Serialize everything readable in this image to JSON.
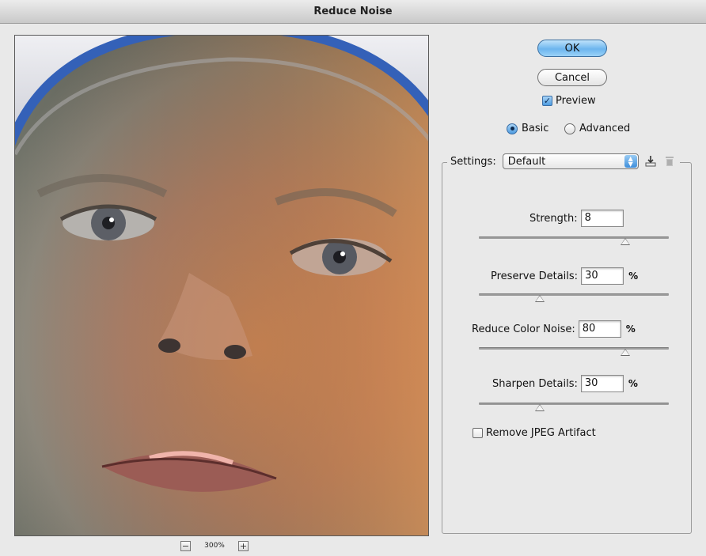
{
  "window": {
    "title": "Reduce Noise"
  },
  "buttons": {
    "ok": "OK",
    "cancel": "Cancel"
  },
  "preview": {
    "label": "Preview",
    "checked": true
  },
  "mode": {
    "basic": "Basic",
    "advanced": "Advanced",
    "selected": "Basic"
  },
  "settings": {
    "label": "Settings:",
    "value": "Default",
    "save_icon": "save-settings-icon",
    "delete_icon": "trash-icon"
  },
  "controls": [
    {
      "label": "Strength:",
      "value": "8",
      "unit": "",
      "fraction": 0.8
    },
    {
      "label": "Preserve Details:",
      "value": "30",
      "unit": "%",
      "fraction": 0.3
    },
    {
      "label": "Reduce Color Noise:",
      "value": "80",
      "unit": "%",
      "fraction": 0.8
    },
    {
      "label": "Sharpen Details:",
      "value": "30",
      "unit": "%",
      "fraction": 0.3
    }
  ],
  "jpeg": {
    "label": "Remove JPEG Artifact",
    "checked": false
  },
  "zoom": {
    "value": "300%",
    "minus": "−",
    "plus": "+"
  }
}
